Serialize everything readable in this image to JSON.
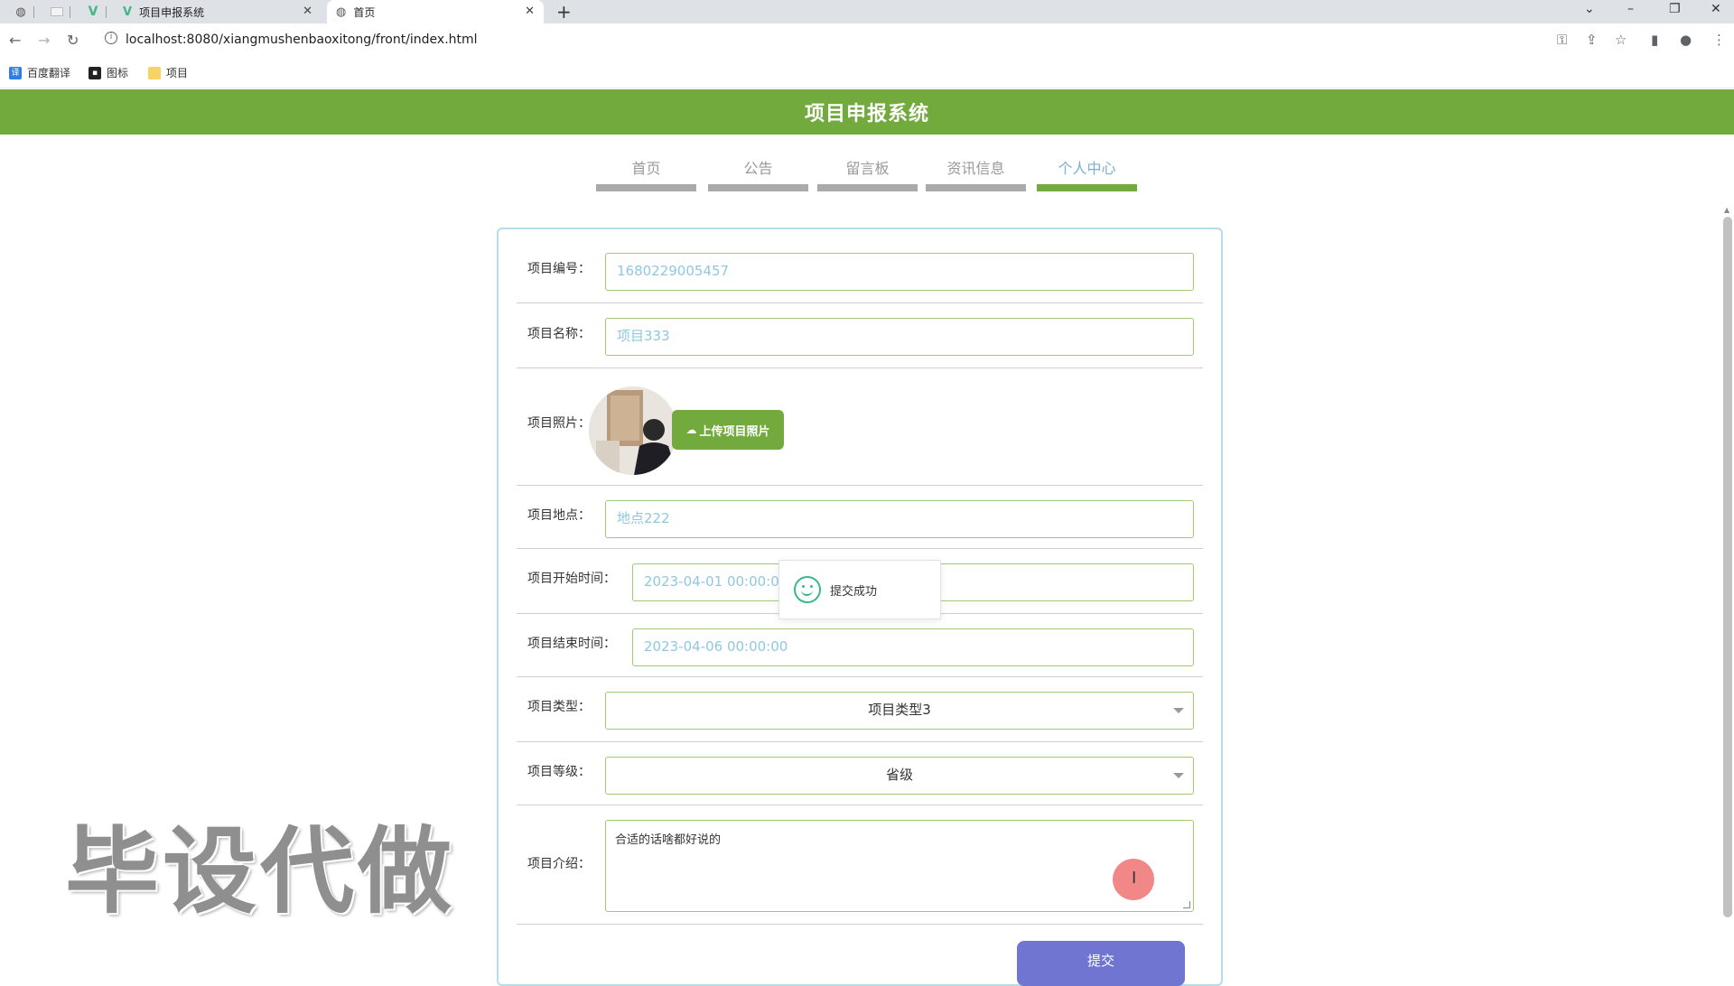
{
  "browser": {
    "tabs": [
      {
        "label": "项目申报系统",
        "icon": "vue-logo-icon",
        "active": false
      },
      {
        "label": "首页",
        "icon": "globe-icon",
        "active": true
      }
    ],
    "url": "localhost:8080/xiangmushenbaoxitong/front/index.html",
    "bookmarks": [
      {
        "label": "百度翻译",
        "icon": "translate-icon"
      },
      {
        "label": "图标",
        "icon": "image-icon"
      },
      {
        "label": "项目",
        "icon": "folder-icon"
      }
    ]
  },
  "site": {
    "title": "项目申报系统",
    "nav": [
      {
        "label": "首页",
        "active": false
      },
      {
        "label": "公告",
        "active": false
      },
      {
        "label": "留言板",
        "active": false
      },
      {
        "label": "资讯信息",
        "active": false
      },
      {
        "label": "个人中心",
        "active": true
      }
    ]
  },
  "form": {
    "project_no": {
      "label": "项目编号：",
      "value": "1680229005457"
    },
    "project_name": {
      "label": "项目名称：",
      "value": "项目333"
    },
    "project_photo": {
      "label": "项目照片：",
      "upload_label": "上传项目照片"
    },
    "project_location": {
      "label": "项目地点：",
      "value": "地点222"
    },
    "start_time": {
      "label": "项目开始时间：",
      "value": "2023-04-01 00:00:00"
    },
    "end_time": {
      "label": "项目结束时间：",
      "value": "2023-04-06 00:00:00"
    },
    "project_type": {
      "label": "项目类型：",
      "value": "项目类型3"
    },
    "project_level": {
      "label": "项目等级：",
      "value": "省级"
    },
    "project_intro": {
      "label": "项目介绍：",
      "value": "合适的话啥都好说的"
    },
    "submit_label": "提交"
  },
  "toast": {
    "message": "提交成功",
    "icon": "smile-icon"
  },
  "watermark": "毕设代做",
  "colors": {
    "header_green": "#72aa3e",
    "input_border": "#9fcb75",
    "submit_purple": "#6f75d1",
    "card_border": "#b5dde8",
    "toast_green": "#35b88a"
  }
}
